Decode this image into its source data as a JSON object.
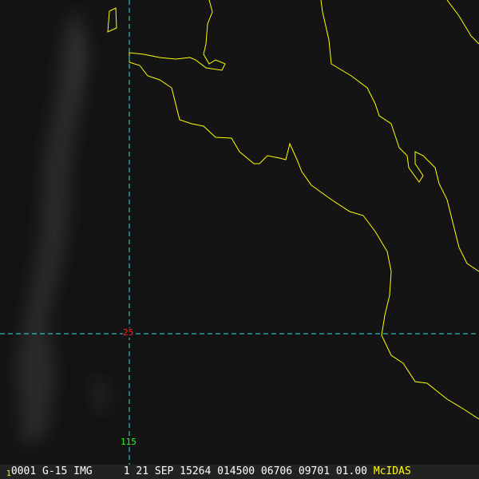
{
  "graticule": {
    "lat_label": "25",
    "lon_label": "115",
    "lat_color": "#ff2020",
    "lon_color": "#20ff20",
    "line_color": "#30e0e0"
  },
  "coastline_color": "#ffff00",
  "status_bar": {
    "frame": "1",
    "text": "0001 G-15 IMG     1 21 SEP 15264 014500 06706 09701 01.00",
    "brand": "McIDAS"
  }
}
